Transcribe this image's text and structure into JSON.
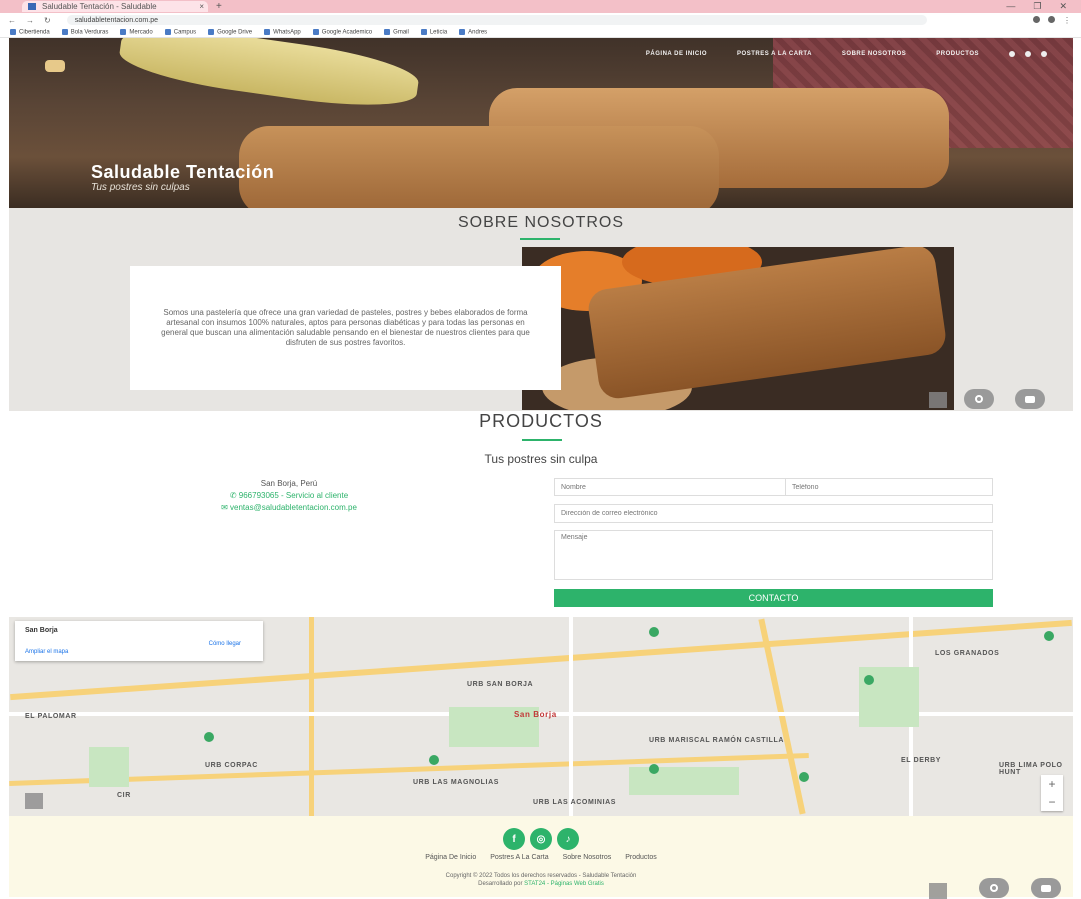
{
  "browser": {
    "tab_title": "Saludable Tentación - Saludable",
    "new_tab": "+",
    "url": "saludabletentacion.com.pe",
    "window_controls": [
      "—",
      "❐",
      "✕"
    ],
    "bookmarks": [
      "Cibertienda",
      "Bola Verduras",
      "Mercado",
      "Campus",
      "Google Drive",
      "WhatsApp",
      "Google Academico",
      "Gmail",
      "Leticia",
      "Andres"
    ]
  },
  "hero": {
    "nav": [
      "PÁGINA DE INICIO",
      "POSTRES A LA CARTA",
      "SOBRE NOSOTROS",
      "PRODUCTOS"
    ],
    "title": "Saludable Tentación",
    "subtitle": "Tus postres sin culpas"
  },
  "about": {
    "heading": "SOBRE NOSOTROS",
    "text": "Somos una pastelería que ofrece una gran variedad de pasteles, postres y bebes elaborados de forma artesanal con insumos 100% naturales, aptos para personas diabéticas y para todas las personas en general que buscan una alimentación saludable pensando en el bienestar de nuestros clientes para que disfruten de sus postres favoritos."
  },
  "products": {
    "heading": "PRODUCTOS",
    "tagline": "Tus postres sin culpa",
    "location": "San Borja, Perú",
    "phone": "966793065 - Servicio al cliente",
    "email": "ventas@saludabletentacion.com.pe",
    "form": {
      "name_placeholder": "Nombre",
      "phone_placeholder": "Teléfono",
      "email_placeholder": "Dirección de correo electrónico",
      "message_placeholder": "Mensaje",
      "submit": "CONTACTO"
    }
  },
  "map": {
    "place": "San Borja",
    "larger_map": "Ampliar el mapa",
    "directions": "Cómo llegar",
    "labels": [
      "URB SAN BORJA",
      "San Borja",
      "EL PALOMAR",
      "URB CORPAC",
      "URB LAS MAGNOLIAS",
      "URB LAS ACOMINIAS",
      "URB MARISCAL RAMÓN CASTILLA",
      "LOS GRANADOS",
      "EL DERBY",
      "URB LIMA POLO HUNT",
      "CIR"
    ]
  },
  "footer": {
    "social": [
      "f",
      "◎",
      "♪"
    ],
    "links": [
      "Página De Inicio",
      "Postres A La Carta",
      "Sobre Nosotros",
      "Productos"
    ],
    "copyright": "Copyright © 2022 Todos los derechos reservados - Saludable Tentación",
    "developed": "Desarrollado por",
    "developer": "STAT24 - Páginas Web Gratis"
  }
}
